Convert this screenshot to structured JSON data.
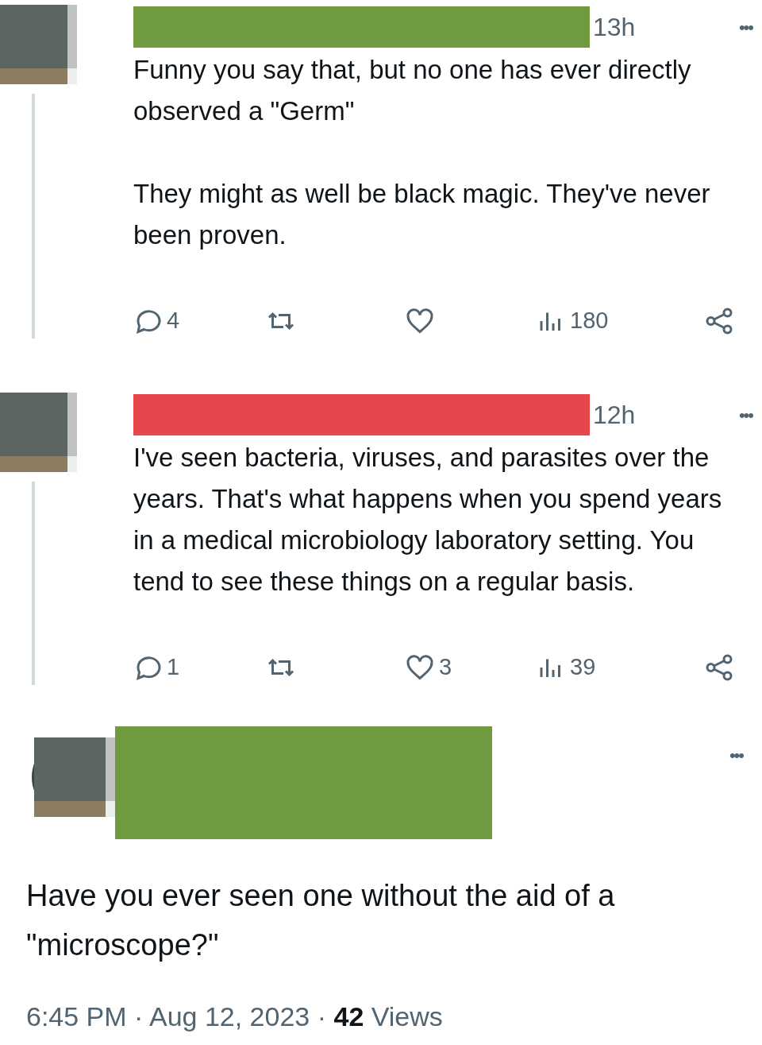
{
  "thread": [
    {
      "redaction": {
        "color": "#6f9a40"
      },
      "time": "13h",
      "more": "•••",
      "paragraphs": [
        "Funny you say that, but no one has ever directly observed a \"Germ\"",
        "They might as well be black magic. They've never been proven."
      ],
      "actions": [
        {
          "kind": "reply",
          "count": "4"
        },
        {
          "kind": "retweet"
        },
        {
          "kind": "like"
        },
        {
          "kind": "views",
          "count": "180"
        },
        {
          "kind": "share"
        }
      ]
    },
    {
      "redaction": {
        "color": "#e5474d"
      },
      "time": "12h",
      "more": "•••",
      "paragraphs": [
        "I've seen bacteria, viruses, and parasites over the years. That's what happens when you spend years in a medical microbiology laboratory setting. You tend to see these things on a regular basis."
      ],
      "actions": [
        {
          "kind": "reply",
          "count": "1"
        },
        {
          "kind": "retweet"
        },
        {
          "kind": "like",
          "count": "3"
        },
        {
          "kind": "views",
          "count": "39"
        },
        {
          "kind": "share"
        }
      ]
    }
  ],
  "main_tweet": {
    "redaction": {
      "color": "#6f9a40"
    },
    "more": "•••",
    "text": "Have you ever seen one without the aid of a \"microscope?\"",
    "meta": "6:45 PM · Aug 12, 2023 · **42** Views"
  }
}
